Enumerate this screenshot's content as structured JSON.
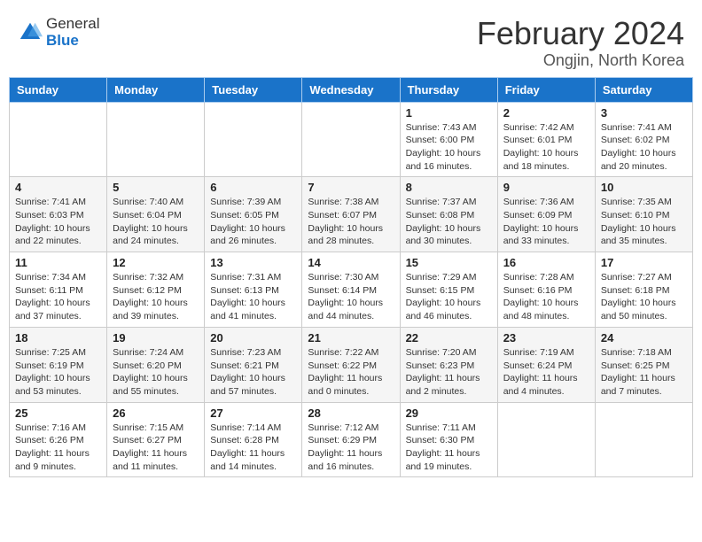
{
  "header": {
    "logo_general": "General",
    "logo_blue": "Blue",
    "main_title": "February 2024",
    "sub_title": "Ongjin, North Korea"
  },
  "weekdays": [
    "Sunday",
    "Monday",
    "Tuesday",
    "Wednesday",
    "Thursday",
    "Friday",
    "Saturday"
  ],
  "weeks": [
    [
      {
        "day": "",
        "info": ""
      },
      {
        "day": "",
        "info": ""
      },
      {
        "day": "",
        "info": ""
      },
      {
        "day": "",
        "info": ""
      },
      {
        "day": "1",
        "info": "Sunrise: 7:43 AM\nSunset: 6:00 PM\nDaylight: 10 hours and 16 minutes."
      },
      {
        "day": "2",
        "info": "Sunrise: 7:42 AM\nSunset: 6:01 PM\nDaylight: 10 hours and 18 minutes."
      },
      {
        "day": "3",
        "info": "Sunrise: 7:41 AM\nSunset: 6:02 PM\nDaylight: 10 hours and 20 minutes."
      }
    ],
    [
      {
        "day": "4",
        "info": "Sunrise: 7:41 AM\nSunset: 6:03 PM\nDaylight: 10 hours and 22 minutes."
      },
      {
        "day": "5",
        "info": "Sunrise: 7:40 AM\nSunset: 6:04 PM\nDaylight: 10 hours and 24 minutes."
      },
      {
        "day": "6",
        "info": "Sunrise: 7:39 AM\nSunset: 6:05 PM\nDaylight: 10 hours and 26 minutes."
      },
      {
        "day": "7",
        "info": "Sunrise: 7:38 AM\nSunset: 6:07 PM\nDaylight: 10 hours and 28 minutes."
      },
      {
        "day": "8",
        "info": "Sunrise: 7:37 AM\nSunset: 6:08 PM\nDaylight: 10 hours and 30 minutes."
      },
      {
        "day": "9",
        "info": "Sunrise: 7:36 AM\nSunset: 6:09 PM\nDaylight: 10 hours and 33 minutes."
      },
      {
        "day": "10",
        "info": "Sunrise: 7:35 AM\nSunset: 6:10 PM\nDaylight: 10 hours and 35 minutes."
      }
    ],
    [
      {
        "day": "11",
        "info": "Sunrise: 7:34 AM\nSunset: 6:11 PM\nDaylight: 10 hours and 37 minutes."
      },
      {
        "day": "12",
        "info": "Sunrise: 7:32 AM\nSunset: 6:12 PM\nDaylight: 10 hours and 39 minutes."
      },
      {
        "day": "13",
        "info": "Sunrise: 7:31 AM\nSunset: 6:13 PM\nDaylight: 10 hours and 41 minutes."
      },
      {
        "day": "14",
        "info": "Sunrise: 7:30 AM\nSunset: 6:14 PM\nDaylight: 10 hours and 44 minutes."
      },
      {
        "day": "15",
        "info": "Sunrise: 7:29 AM\nSunset: 6:15 PM\nDaylight: 10 hours and 46 minutes."
      },
      {
        "day": "16",
        "info": "Sunrise: 7:28 AM\nSunset: 6:16 PM\nDaylight: 10 hours and 48 minutes."
      },
      {
        "day": "17",
        "info": "Sunrise: 7:27 AM\nSunset: 6:18 PM\nDaylight: 10 hours and 50 minutes."
      }
    ],
    [
      {
        "day": "18",
        "info": "Sunrise: 7:25 AM\nSunset: 6:19 PM\nDaylight: 10 hours and 53 minutes."
      },
      {
        "day": "19",
        "info": "Sunrise: 7:24 AM\nSunset: 6:20 PM\nDaylight: 10 hours and 55 minutes."
      },
      {
        "day": "20",
        "info": "Sunrise: 7:23 AM\nSunset: 6:21 PM\nDaylight: 10 hours and 57 minutes."
      },
      {
        "day": "21",
        "info": "Sunrise: 7:22 AM\nSunset: 6:22 PM\nDaylight: 11 hours and 0 minutes."
      },
      {
        "day": "22",
        "info": "Sunrise: 7:20 AM\nSunset: 6:23 PM\nDaylight: 11 hours and 2 minutes."
      },
      {
        "day": "23",
        "info": "Sunrise: 7:19 AM\nSunset: 6:24 PM\nDaylight: 11 hours and 4 minutes."
      },
      {
        "day": "24",
        "info": "Sunrise: 7:18 AM\nSunset: 6:25 PM\nDaylight: 11 hours and 7 minutes."
      }
    ],
    [
      {
        "day": "25",
        "info": "Sunrise: 7:16 AM\nSunset: 6:26 PM\nDaylight: 11 hours and 9 minutes."
      },
      {
        "day": "26",
        "info": "Sunrise: 7:15 AM\nSunset: 6:27 PM\nDaylight: 11 hours and 11 minutes."
      },
      {
        "day": "27",
        "info": "Sunrise: 7:14 AM\nSunset: 6:28 PM\nDaylight: 11 hours and 14 minutes."
      },
      {
        "day": "28",
        "info": "Sunrise: 7:12 AM\nSunset: 6:29 PM\nDaylight: 11 hours and 16 minutes."
      },
      {
        "day": "29",
        "info": "Sunrise: 7:11 AM\nSunset: 6:30 PM\nDaylight: 11 hours and 19 minutes."
      },
      {
        "day": "",
        "info": ""
      },
      {
        "day": "",
        "info": ""
      }
    ]
  ]
}
